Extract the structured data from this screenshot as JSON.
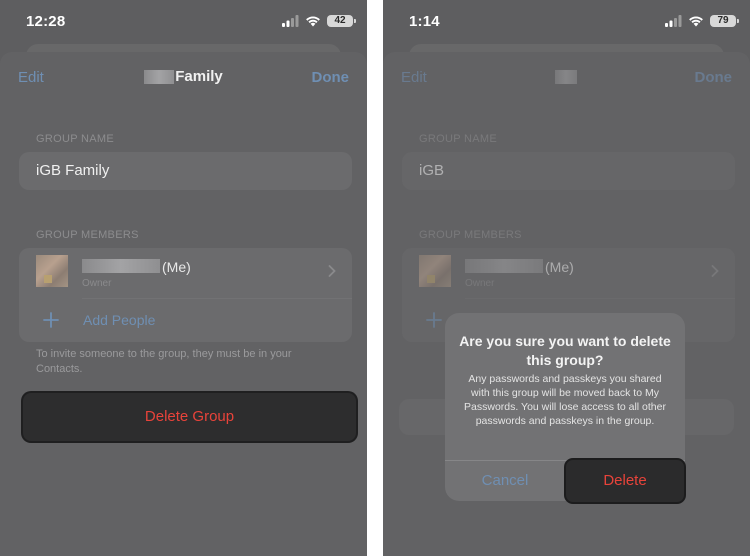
{
  "left": {
    "status": {
      "time": "12:28",
      "battery": "42"
    },
    "nav": {
      "edit": "Edit",
      "title": "Family",
      "done": "Done"
    },
    "group_name_header": "GROUP NAME",
    "group_name_value": "iGB Family",
    "group_members_header": "GROUP MEMBERS",
    "member": {
      "me_suffix": "(Me)",
      "role": "Owner"
    },
    "add_people": "Add People",
    "footnote": "To invite someone to the group, they must be in your Contacts.",
    "delete_group": "Delete Group"
  },
  "right": {
    "status": {
      "time": "1:14",
      "battery": "79"
    },
    "nav": {
      "edit": "Edit",
      "done": "Done"
    },
    "group_name_header": "GROUP NAME",
    "group_name_value": "iGB",
    "group_members_header": "GROUP MEMBERS",
    "member": {
      "me_suffix": "(Me)",
      "role": "Owner"
    },
    "alert": {
      "title": "Are you sure you want to delete this group?",
      "message": "Any passwords and passkeys you shared with this group will be moved back to My Passwords. You will lose access to all other passwords and passkeys in the group.",
      "cancel": "Cancel",
      "delete": "Delete"
    }
  },
  "colors": {
    "accent": "#6f8fb3",
    "destructive": "#e8433a",
    "overlay": "#5e5e60"
  }
}
